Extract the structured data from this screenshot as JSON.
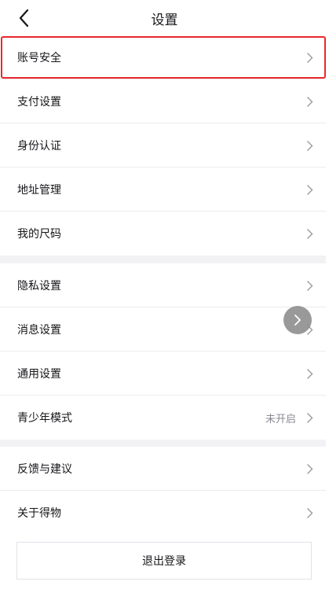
{
  "header": {
    "title": "设置",
    "back_icon": "chevron-left-icon"
  },
  "groups": [
    {
      "items": [
        {
          "label": "账号安全",
          "value": ""
        },
        {
          "label": "支付设置",
          "value": ""
        },
        {
          "label": "身份认证",
          "value": ""
        },
        {
          "label": "地址管理",
          "value": ""
        },
        {
          "label": "我的尺码",
          "value": ""
        }
      ]
    },
    {
      "items": [
        {
          "label": "隐私设置",
          "value": ""
        },
        {
          "label": "消息设置",
          "value": ""
        },
        {
          "label": "通用设置",
          "value": ""
        },
        {
          "label": "青少年模式",
          "value": "未开启"
        }
      ]
    },
    {
      "items": [
        {
          "label": "反馈与建议",
          "value": ""
        },
        {
          "label": "关于得物",
          "value": ""
        }
      ]
    }
  ],
  "logout": {
    "label": "退出登录"
  },
  "colors": {
    "highlight": "#e8292b",
    "background": "#f2f2f5",
    "text": "#16161a",
    "muted": "#8a8a94"
  }
}
